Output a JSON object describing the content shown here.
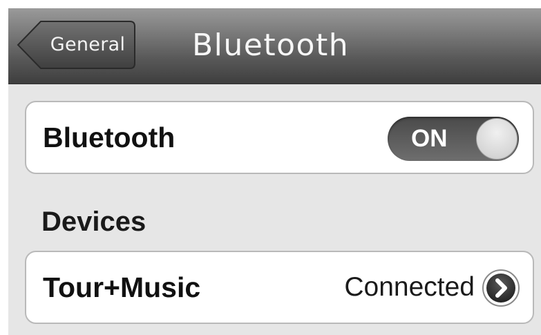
{
  "navbar": {
    "back_label": "General",
    "title": "Bluetooth"
  },
  "bluetooth_cell": {
    "label": "Bluetooth",
    "toggle_label": "ON",
    "toggle_on": true
  },
  "devices": {
    "section_title": "Devices",
    "items": [
      {
        "name": "Tour+Music",
        "status": "Connected",
        "icon": "chevron-right-icon"
      }
    ]
  },
  "colors": {
    "navbar_top": "#9a9a9a",
    "navbar_bottom": "#3e3e3e",
    "background": "#e6e6e6",
    "toggle_track": "#5c5c5c"
  }
}
